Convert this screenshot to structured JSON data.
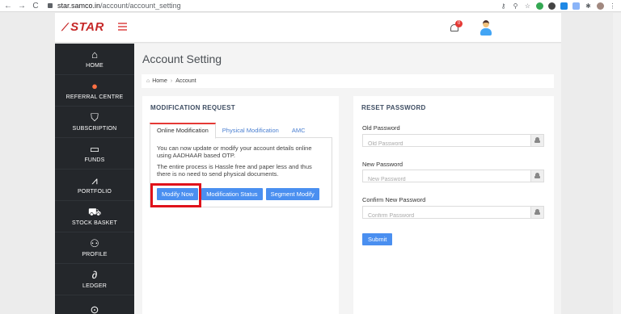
{
  "browser": {
    "url_host": "star.samco.in",
    "url_path": "/account/account_setting",
    "nav": {
      "back": "←",
      "forward": "→",
      "reload": "C"
    }
  },
  "header": {
    "logo_text": "STAR",
    "notification_count": "0"
  },
  "sidebar": {
    "items": [
      {
        "label": "HOME",
        "icon": "⌂"
      },
      {
        "label": "REFERRAL CENTRE",
        "icon": "●"
      },
      {
        "label": "SUBSCRIPTION",
        "icon": "⛉"
      },
      {
        "label": "FUNDS",
        "icon": "▭"
      },
      {
        "label": "PORTFOLIO",
        "icon": "⩘"
      },
      {
        "label": "STOCK BASKET",
        "icon": "⛟"
      },
      {
        "label": "PROFILE",
        "icon": "⚇"
      },
      {
        "label": "LEDGER",
        "icon": "∂"
      },
      {
        "label": "",
        "icon": "⊙"
      }
    ]
  },
  "main": {
    "title": "Account Setting",
    "breadcrumb": {
      "home": "Home",
      "current": "Account"
    },
    "modification": {
      "title": "MODIFICATION REQUEST",
      "tabs": [
        "Online Modification",
        "Physical Modification",
        "AMC"
      ],
      "text1": "You can now update or modify your account details online using AADHAAR based OTP.",
      "text2": "The entire process is Hassle free and paper less and thus there is no need to send physical documents.",
      "buttons": [
        "Modify Now",
        "Modification Status",
        "Segment Modify"
      ]
    },
    "reset": {
      "title": "RESET PASSWORD",
      "old_label": "Old Password",
      "old_placeholder": "Old Password",
      "new_label": "New Password",
      "new_placeholder": "New Password",
      "confirm_label": "Confirm New Password",
      "confirm_placeholder": "Confirm Password",
      "submit_label": "Submit"
    }
  },
  "colors": {
    "accent": "#4a8ff0",
    "sidebar": "#24272b",
    "brand": "#c62828",
    "highlight": "#e0121b"
  }
}
